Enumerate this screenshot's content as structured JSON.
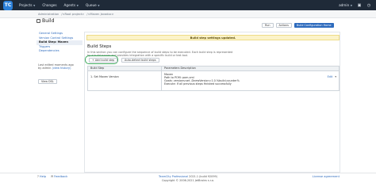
{
  "topbar": {
    "logo": "TC",
    "nav": [
      "Projects",
      "Changes",
      "Agents",
      "Queue"
    ],
    "user": "admin",
    "icons": [
      "agents-icon",
      "clock-icon"
    ]
  },
  "breadcrumb": [
    "Administration",
    "/<Root project>",
    "/<Maven Javadoc>"
  ],
  "header": {
    "title": "Build",
    "actions": [
      "Run",
      "Actions"
    ],
    "edit_config": "Build Configuration Home"
  },
  "sidebar": {
    "items": [
      "General Settings",
      "Version Control Settings",
      "Build Step: Maven",
      "Triggers",
      "Dependencies"
    ],
    "active_index": 2,
    "info_line1": "Last edited moments ago",
    "info_by": "by admin",
    "info_link": "(view history)",
    "view_dsl": "View DSL"
  },
  "main": {
    "flash": "Build step settings updated.",
    "section_title": "Build Steps",
    "section_desc_1": "In this section you can configure the sequence of build steps to be executed. Each build step is represented",
    "section_desc_2": "by a build runner and provides integration with a specific build or test tool.",
    "add_button": "+ Add build step",
    "detect_button": "Auto-detect build steps",
    "table_headers": [
      "Build Step",
      "Parameters Description"
    ],
    "rows": [
      {
        "step": "1. Set Maven Version",
        "params": [
          "Maven",
          "Path to POM: pom.xml",
          "Goals: versions:set -DnewVersion=1.0.%build.counter%",
          "Execute: If all previous steps finished successfully"
        ],
        "edit": "Edit",
        "more": "▾"
      }
    ]
  },
  "footer": {
    "help": "Help",
    "feedback": "Feedback",
    "center_prefix": "TeamCity Professional",
    "center_version": "2021.1 (build 92099)",
    "copyright": "Copyright © 2006-2021 JetBrains s.r.o.",
    "license": "License agreement"
  }
}
